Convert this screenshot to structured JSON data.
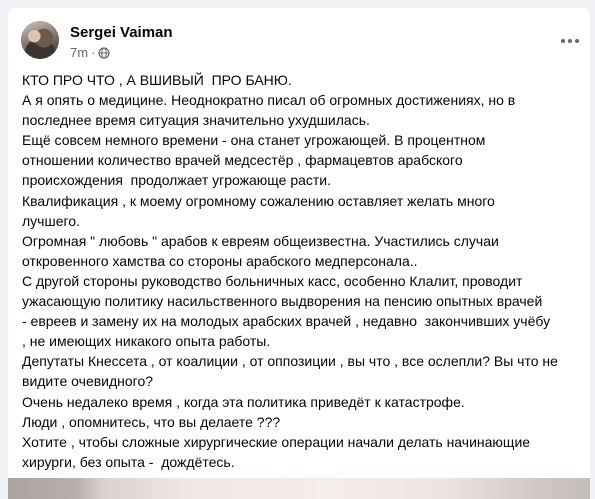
{
  "post": {
    "author": "Sergei Vaiman",
    "time": "7m",
    "separator": "·",
    "privacy_icon": "globe-icon",
    "menu_icon": "more-horizontal-icon",
    "lines": [
      "КТО ПРО ЧТО , А ВШИВЫЙ  ПРО БАНЮ.",
      "А я опять о медицине. Неоднократно писал об огромных достижениях, но в",
      "последнее время ситуация значительно ухудшилась.",
      "Ещё совсем немного времени - она станет угрожающей. В процентном",
      "отношении количество врачей медсестёр , фармацевтов арабского",
      "происхождения  продолжает угрожающе расти.",
      "Квалификация , к моему огромному сожалению оставляет желать много",
      "лучшего.",
      "Огромная \" любовь \" арабов к евреям общеизвестна. Участились случаи",
      "откровенного хамства со стороны арабского медперсонала..",
      "С другой стороны руководство больничных касс, особенно Клалит, проводит",
      "ужасающую политику насильственного выдворения на пенсию опытных врачей",
      "- евреев и замену их на молодых арабских врачей , недавно  закончивших учёбу",
      ", не имеющих никакого опыта работы.",
      "Депутаты Кнессета , от коалиции , от оппозиции , вы что , все ослепли? Вы что не",
      "видите очевидного?",
      "Очень недалеко время , когда эта политика приведёт к катастрофе.",
      "Люди , опомнитесь, что вы делаете ???",
      "Хотите , чтобы сложные хирургические операции начали делать начинающие",
      "хирурги, без опыта -  дождётесь."
    ]
  },
  "colors": {
    "page_background": "#f0f2f5",
    "card_background": "#ffffff",
    "primary_text": "#050505",
    "secondary_text": "#65676b"
  }
}
